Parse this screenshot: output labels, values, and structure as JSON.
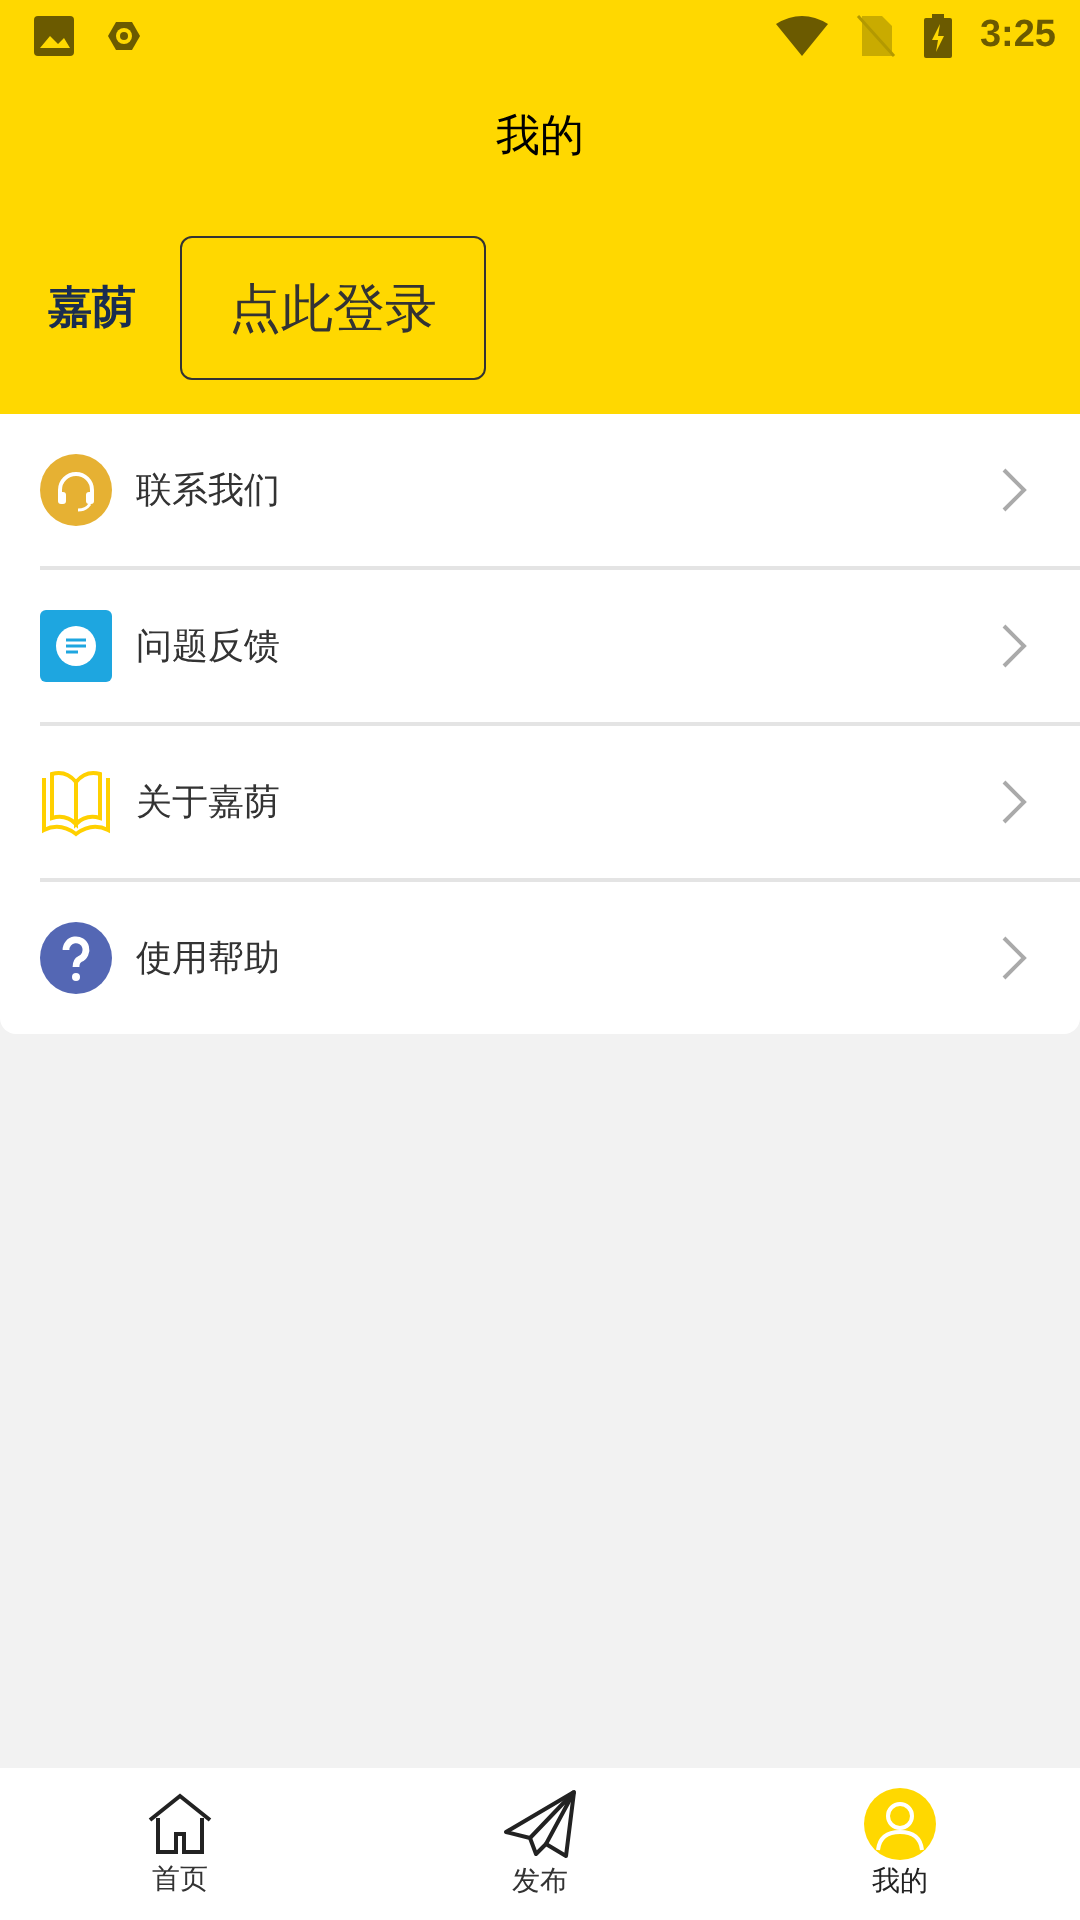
{
  "status_bar": {
    "time": "3:25"
  },
  "header": {
    "title": "我的",
    "brand": "嘉荫",
    "login_button": "点此登录"
  },
  "menu": [
    {
      "kind": "headset",
      "label": "联系我们"
    },
    {
      "kind": "chat",
      "label": "问题反馈"
    },
    {
      "kind": "book",
      "label": "关于嘉荫"
    },
    {
      "kind": "help",
      "label": "使用帮助"
    }
  ],
  "tabs": [
    {
      "kind": "home",
      "label": "首页",
      "selected": false
    },
    {
      "kind": "publish",
      "label": "发布",
      "selected": false
    },
    {
      "kind": "profile",
      "label": "我的",
      "selected": true
    }
  ]
}
